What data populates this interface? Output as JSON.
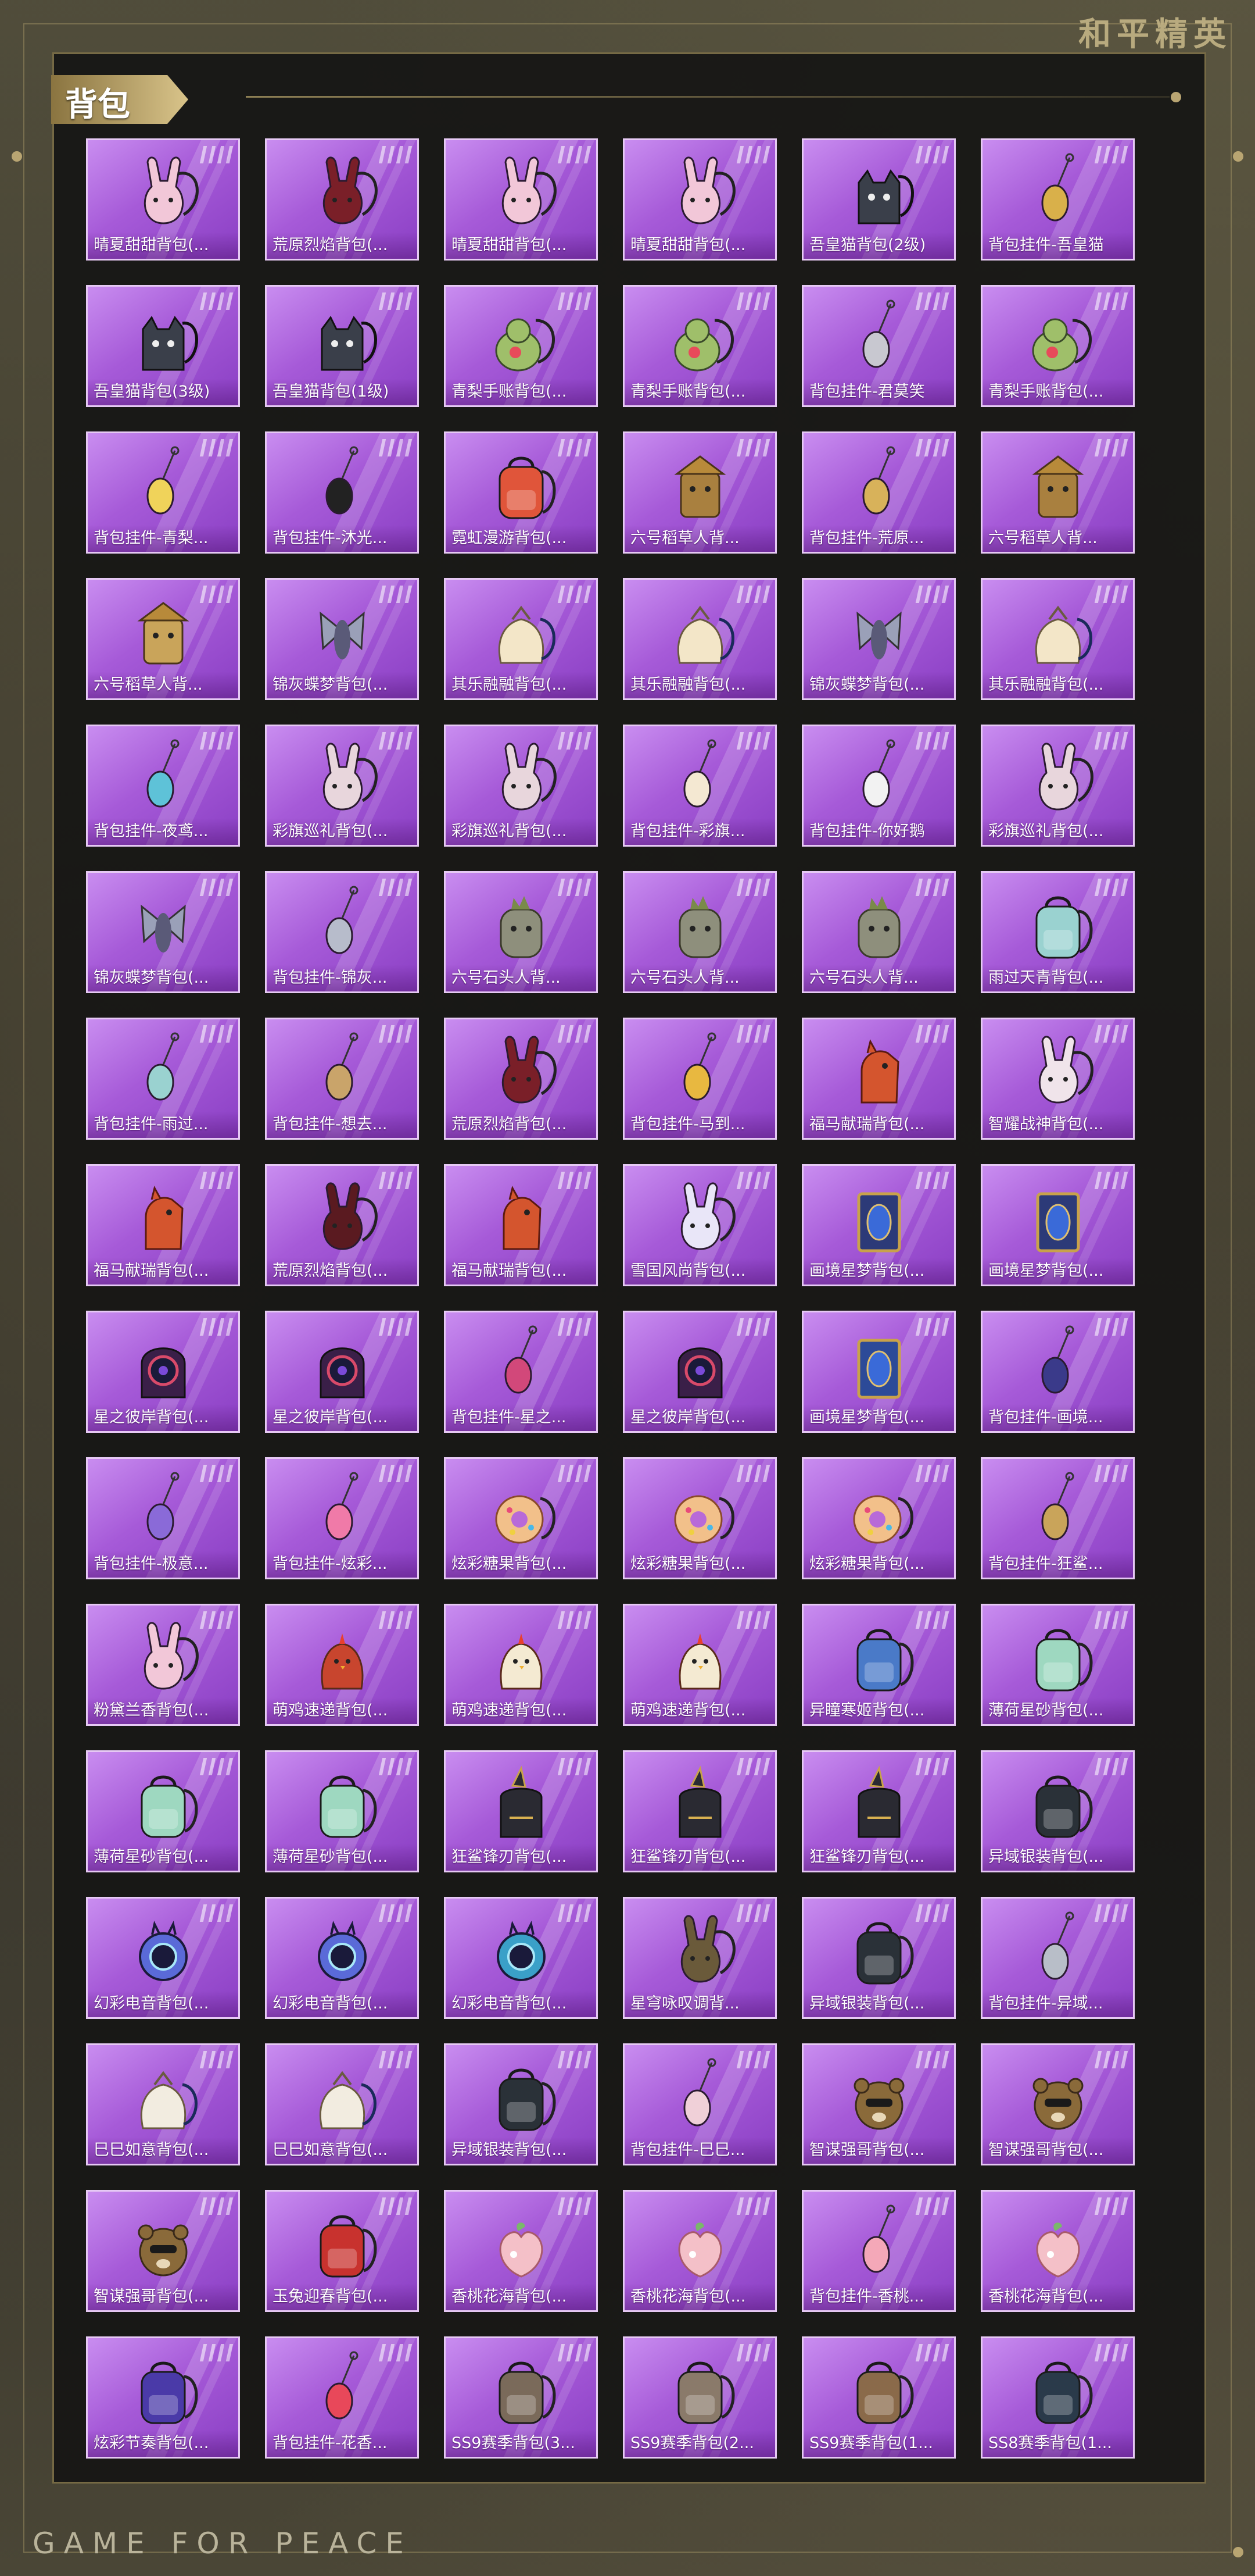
{
  "brand": "和平精英",
  "section_title": "背包",
  "footer": "GAME FOR PEACE",
  "colors": {
    "card_top": "#c98df0",
    "card_bottom": "#8a3fc4",
    "card_border": "#e6c9f4",
    "gold": "#c9b98a"
  },
  "items": [
    {
      "name": "晴夏甜甜背包(...",
      "icon": "bunny-backpack-icon",
      "color": "#f2c7d8"
    },
    {
      "name": "荒原烈焰背包(...",
      "icon": "bunny-backpack-icon",
      "color": "#7a1f28"
    },
    {
      "name": "晴夏甜甜背包(...",
      "icon": "bunny-backpack-icon",
      "color": "#f2c7d8"
    },
    {
      "name": "晴夏甜甜背包(...",
      "icon": "bunny-backpack-icon",
      "color": "#f2c7d8"
    },
    {
      "name": "吾皇猫背包(2级)",
      "icon": "cat-backpack-icon",
      "color": "#3a3f4a"
    },
    {
      "name": "背包挂件-吾皇猫",
      "icon": "charm-pendant-icon",
      "color": "#d9b04a"
    },
    {
      "name": "吾皇猫背包(3级)",
      "icon": "cat-backpack-icon",
      "color": "#3a3f4a"
    },
    {
      "name": "吾皇猫背包(1级)",
      "icon": "cat-backpack-icon",
      "color": "#3a3f4a"
    },
    {
      "name": "青梨手账背包(...",
      "icon": "pear-backpack-icon",
      "color": "#9fbf6a"
    },
    {
      "name": "青梨手账背包(...",
      "icon": "pear-backpack-icon",
      "color": "#9fbf6a"
    },
    {
      "name": "背包挂件-君莫笑",
      "icon": "charm-pendant-icon",
      "color": "#c8c8d0"
    },
    {
      "name": "青梨手账背包(...",
      "icon": "pear-backpack-icon",
      "color": "#9fbf6a"
    },
    {
      "name": "背包挂件-青梨...",
      "icon": "charm-pendant-icon",
      "color": "#f0d35a"
    },
    {
      "name": "背包挂件-沐光...",
      "icon": "charm-pendant-icon",
      "color": "#222222"
    },
    {
      "name": "霓虹漫游背包(...",
      "icon": "backpack-icon",
      "color": "#e0553a"
    },
    {
      "name": "六号稻草人背...",
      "icon": "scarecrow-backpack-icon",
      "color": "#a9803f"
    },
    {
      "name": "背包挂件-荒原...",
      "icon": "charm-pendant-icon",
      "color": "#d8b25a"
    },
    {
      "name": "六号稻草人背...",
      "icon": "scarecrow-backpack-icon",
      "color": "#a9803f"
    },
    {
      "name": "六号稻草人背...",
      "icon": "scarecrow-backpack-icon",
      "color": "#c9a45a"
    },
    {
      "name": "锦灰蝶梦背包(...",
      "icon": "butterfly-backpack-icon",
      "color": "#9aa0b8"
    },
    {
      "name": "其乐融融背包(...",
      "icon": "sack-backpack-icon",
      "color": "#f3e6c8"
    },
    {
      "name": "其乐融融背包(...",
      "icon": "sack-backpack-icon",
      "color": "#f3e6c8"
    },
    {
      "name": "锦灰蝶梦背包(...",
      "icon": "butterfly-backpack-icon",
      "color": "#9aa0b8"
    },
    {
      "name": "其乐融融背包(...",
      "icon": "sack-backpack-icon",
      "color": "#f3e6c8"
    },
    {
      "name": "背包挂件-夜鸢...",
      "icon": "charm-pendant-icon",
      "color": "#5ec2d8"
    },
    {
      "name": "彩旗巡礼背包(...",
      "icon": "bunny-backpack-icon",
      "color": "#e8d6dc"
    },
    {
      "name": "彩旗巡礼背包(...",
      "icon": "bunny-backpack-icon",
      "color": "#e8d6dc"
    },
    {
      "name": "背包挂件-彩旗...",
      "icon": "charm-pendant-icon",
      "color": "#f4e8d2"
    },
    {
      "name": "背包挂件-你好鹅",
      "icon": "charm-pendant-icon",
      "color": "#f2f2f2"
    },
    {
      "name": "彩旗巡礼背包(...",
      "icon": "bunny-backpack-icon",
      "color": "#e8d6dc"
    },
    {
      "name": "锦灰蝶梦背包(...",
      "icon": "butterfly-backpack-icon",
      "color": "#9aa0b8"
    },
    {
      "name": "背包挂件-锦灰...",
      "icon": "charm-pendant-icon",
      "color": "#b7bccb"
    },
    {
      "name": "六号石头人背...",
      "icon": "stone-backpack-icon",
      "color": "#8e8f7c"
    },
    {
      "name": "六号石头人背...",
      "icon": "stone-backpack-icon",
      "color": "#8e8f7c"
    },
    {
      "name": "六号石头人背...",
      "icon": "stone-backpack-icon",
      "color": "#8e8f7c"
    },
    {
      "name": "雨过天青背包(...",
      "icon": "backpack-icon",
      "color": "#9ad2d0"
    },
    {
      "name": "背包挂件-雨过...",
      "icon": "charm-pendant-icon",
      "color": "#9ad2d0"
    },
    {
      "name": "背包挂件-想去...",
      "icon": "charm-pendant-icon",
      "color": "#c9a46a"
    },
    {
      "name": "荒原烈焰背包(...",
      "icon": "bunny-backpack-icon",
      "color": "#7a1f28"
    },
    {
      "name": "背包挂件-马到...",
      "icon": "charm-pendant-icon",
      "color": "#e8b840"
    },
    {
      "name": "福马献瑞背包(...",
      "icon": "horse-backpack-icon",
      "color": "#d4552e"
    },
    {
      "name": "智耀战神背包(...",
      "icon": "bunny-backpack-icon",
      "color": "#f0e4ea"
    },
    {
      "name": "福马献瑞背包(...",
      "icon": "horse-backpack-icon",
      "color": "#d4552e"
    },
    {
      "name": "荒原烈焰背包(...",
      "icon": "bunny-backpack-icon",
      "color": "#5a1a20"
    },
    {
      "name": "福马献瑞背包(...",
      "icon": "horse-backpack-icon",
      "color": "#d4552e"
    },
    {
      "name": "雪国风尚背包(...",
      "icon": "bunny-backpack-icon",
      "color": "#e9e6f8"
    },
    {
      "name": "画境星梦背包(...",
      "icon": "frame-backpack-icon",
      "color": "#2c3a78"
    },
    {
      "name": "画境星梦背包(...",
      "icon": "frame-backpack-icon",
      "color": "#2c3a78"
    },
    {
      "name": "星之彼岸背包(...",
      "icon": "planet-backpack-icon",
      "color": "#3a1f48"
    },
    {
      "name": "星之彼岸背包(...",
      "icon": "planet-backpack-icon",
      "color": "#3a1f48"
    },
    {
      "name": "背包挂件-星之...",
      "icon": "charm-pendant-icon",
      "color": "#d2487a"
    },
    {
      "name": "星之彼岸背包(...",
      "icon": "planet-backpack-icon",
      "color": "#3a1f48"
    },
    {
      "name": "画境星梦背包(...",
      "icon": "frame-backpack-icon",
      "color": "#2c4a98"
    },
    {
      "name": "背包挂件-画境...",
      "icon": "charm-pendant-icon",
      "color": "#3a3a8a"
    },
    {
      "name": "背包挂件-极意...",
      "icon": "charm-pendant-icon",
      "color": "#8a6ad8"
    },
    {
      "name": "背包挂件-炫彩...",
      "icon": "charm-pendant-icon",
      "color": "#f07aa8"
    },
    {
      "name": "炫彩糖果背包(...",
      "icon": "donut-backpack-icon",
      "color": "#f2c08a"
    },
    {
      "name": "炫彩糖果背包(...",
      "icon": "donut-backpack-icon",
      "color": "#f2c08a"
    },
    {
      "name": "炫彩糖果背包(...",
      "icon": "donut-backpack-icon",
      "color": "#f2c08a"
    },
    {
      "name": "背包挂件-狂鲨...",
      "icon": "charm-pendant-icon",
      "color": "#c9a45a"
    },
    {
      "name": "粉黛兰香背包(...",
      "icon": "bunny-backpack-icon",
      "color": "#f2c7d8"
    },
    {
      "name": "萌鸡速递背包(...",
      "icon": "chick-backpack-icon",
      "color": "#c8452e"
    },
    {
      "name": "萌鸡速递背包(...",
      "icon": "chick-backpack-icon",
      "color": "#f4ead2"
    },
    {
      "name": "萌鸡速递背包(...",
      "icon": "chick-backpack-icon",
      "color": "#f4ead2"
    },
    {
      "name": "异瞳寒姬背包(...",
      "icon": "backpack-icon",
      "color": "#4a7ac8"
    },
    {
      "name": "薄荷星砂背包(...",
      "icon": "backpack-icon",
      "color": "#9ed8c0"
    },
    {
      "name": "薄荷星砂背包(...",
      "icon": "backpack-icon",
      "color": "#9ed8c0"
    },
    {
      "name": "薄荷星砂背包(...",
      "icon": "backpack-icon",
      "color": "#9ed8c0"
    },
    {
      "name": "狂鲨锋刃背包(...",
      "icon": "shark-backpack-icon",
      "color": "#2a2a32"
    },
    {
      "name": "狂鲨锋刃背包(...",
      "icon": "shark-backpack-icon",
      "color": "#2a2a32"
    },
    {
      "name": "狂鲨锋刃背包(...",
      "icon": "shark-backpack-icon",
      "color": "#2a2a32"
    },
    {
      "name": "异域银装背包(...",
      "icon": "backpack-icon",
      "color": "#2a3138"
    },
    {
      "name": "幻彩电音背包(...",
      "icon": "speaker-backpack-icon",
      "color": "#5a6ad8"
    },
    {
      "name": "幻彩电音背包(...",
      "icon": "speaker-backpack-icon",
      "color": "#5a6ad8"
    },
    {
      "name": "幻彩电音背包(...",
      "icon": "speaker-backpack-icon",
      "color": "#3aa0c8"
    },
    {
      "name": "星穹咏叹调背...",
      "icon": "bunny-backpack-icon",
      "color": "#6a5a3a"
    },
    {
      "name": "异域银装背包(...",
      "icon": "backpack-icon",
      "color": "#2a3138"
    },
    {
      "name": "背包挂件-异域...",
      "icon": "charm-pendant-icon",
      "color": "#b8bec8"
    },
    {
      "name": "巳巳如意背包(...",
      "icon": "sack-backpack-icon",
      "color": "#f2ece0"
    },
    {
      "name": "巳巳如意背包(...",
      "icon": "sack-backpack-icon",
      "color": "#f2ece0"
    },
    {
      "name": "异域银装背包(...",
      "icon": "backpack-icon",
      "color": "#2a3138"
    },
    {
      "name": "背包挂件-巳巳...",
      "icon": "charm-pendant-icon",
      "color": "#f0d0d8"
    },
    {
      "name": "智谋强哥背包(...",
      "icon": "bear-backpack-icon",
      "color": "#8a6a3a"
    },
    {
      "name": "智谋强哥背包(...",
      "icon": "bear-backpack-icon",
      "color": "#8a6a3a"
    },
    {
      "name": "智谋强哥背包(...",
      "icon": "bear-backpack-icon",
      "color": "#8a6a3a"
    },
    {
      "name": "玉兔迎春背包(...",
      "icon": "backpack-icon",
      "color": "#c8322e"
    },
    {
      "name": "香桃花海背包(...",
      "icon": "peach-backpack-icon",
      "color": "#f4c0c8"
    },
    {
      "name": "香桃花海背包(...",
      "icon": "peach-backpack-icon",
      "color": "#f4c0c8"
    },
    {
      "name": "背包挂件-香桃...",
      "icon": "charm-pendant-icon",
      "color": "#f4a8b8"
    },
    {
      "name": "香桃花海背包(...",
      "icon": "peach-backpack-icon",
      "color": "#f4c0c8"
    },
    {
      "name": "炫彩节奏背包(...",
      "icon": "backpack-icon",
      "color": "#4a3aa8"
    },
    {
      "name": "背包挂件-花香...",
      "icon": "charm-pendant-icon",
      "color": "#e8485a"
    },
    {
      "name": "SS9赛季背包(3...",
      "icon": "backpack-icon",
      "color": "#7a6a5a"
    },
    {
      "name": "SS9赛季背包(2...",
      "icon": "backpack-icon",
      "color": "#8a7a6a"
    },
    {
      "name": "SS9赛季背包(1...",
      "icon": "backpack-icon",
      "color": "#8a6a4a"
    },
    {
      "name": "SS8赛季背包(1...",
      "icon": "backpack-icon",
      "color": "#2a3a4a"
    }
  ]
}
